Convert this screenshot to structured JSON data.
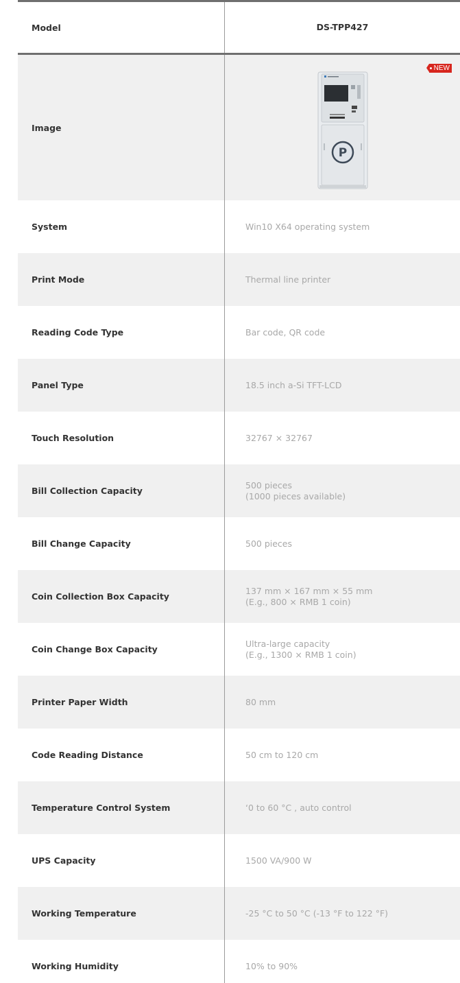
{
  "table": {
    "header": {
      "label": "Model",
      "value": "DS-TPP427"
    },
    "image_row": {
      "label": "Image",
      "badge": "NEW",
      "image_icon": "parking-kiosk-icon"
    },
    "rows": [
      {
        "label": "System",
        "value": "Win10 X64 operating system"
      },
      {
        "label": "Print Mode",
        "value": "Thermal line printer"
      },
      {
        "label": "Reading Code Type",
        "value": "Bar code, QR code"
      },
      {
        "label": "Panel Type",
        "value": "18.5 inch a-Si TFT-LCD"
      },
      {
        "label": "Touch Resolution",
        "value": "32767 × 32767"
      },
      {
        "label": "Bill Collection Capacity",
        "value": "500 pieces\n(1000 pieces available)"
      },
      {
        "label": "Bill Change Capacity",
        "value": "500 pieces"
      },
      {
        "label": "Coin Collection Box Capacity",
        "value": "137 mm × 167 mm × 55 mm\n(E.g., 800 × RMB 1 coin)"
      },
      {
        "label": "Coin Change Box Capacity",
        "value": "Ultra-large capacity\n(E.g., 1300 × RMB 1 coin)"
      },
      {
        "label": "Printer Paper Width",
        "value": "80 mm"
      },
      {
        "label": "Code Reading Distance",
        "value": "50 cm to 120 cm"
      },
      {
        "label": "Temperature Control System",
        "value": "‘0 to 60 °C , auto control"
      },
      {
        "label": "UPS Capacity",
        "value": "1500 VA/900 W"
      },
      {
        "label": "Working Temperature",
        "value": "-25 °C to 50 °C  (-13 °F to 122 °F)"
      },
      {
        "label": "Working Humidity",
        "value": "10% to 90%"
      }
    ]
  },
  "colors": {
    "badge": "#d7261e",
    "grey_row": "#f0f0f0",
    "rule": "#6f6f6f"
  }
}
